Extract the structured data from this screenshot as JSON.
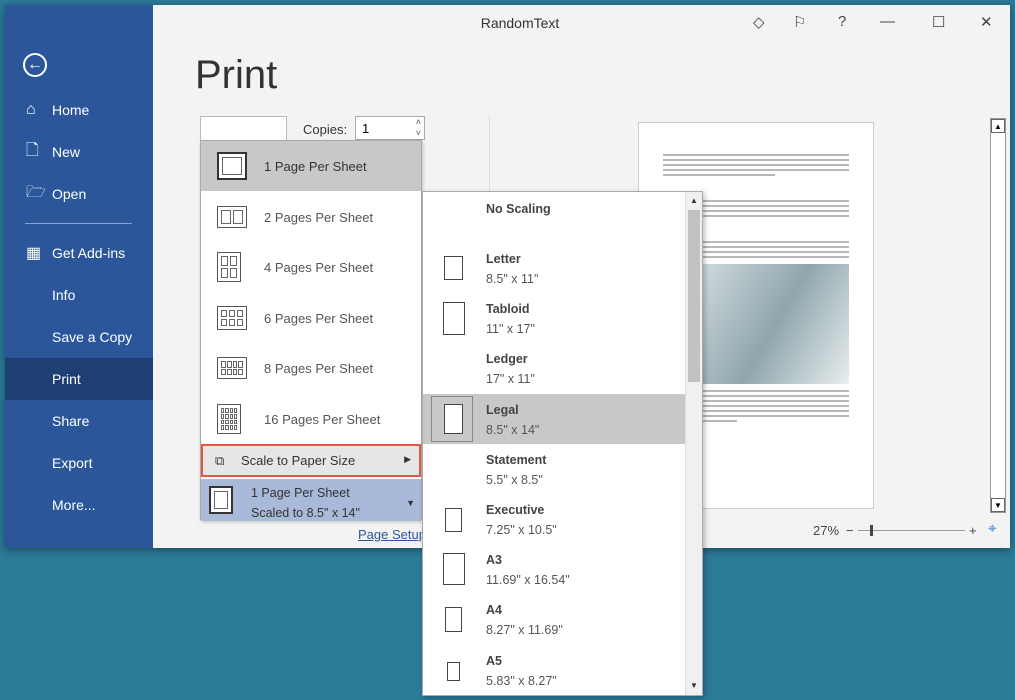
{
  "window": {
    "title": "RandomText",
    "icons": [
      "diamond-icon",
      "feedback-icon",
      "help-icon",
      "minimize-icon",
      "maximize-icon",
      "close-icon"
    ]
  },
  "sidebar": {
    "items": [
      {
        "label": "Home",
        "icon": "home-icon"
      },
      {
        "label": "New",
        "icon": "new-document-icon"
      },
      {
        "label": "Open",
        "icon": "folder-open-icon"
      },
      {
        "label": "Get Add-ins",
        "icon": "add-ins-icon"
      },
      {
        "label": "Info"
      },
      {
        "label": "Save a Copy"
      },
      {
        "label": "Print",
        "selected": true
      },
      {
        "label": "Share"
      },
      {
        "label": "Export"
      },
      {
        "label": "More..."
      }
    ]
  },
  "main": {
    "heading": "Print",
    "copies_label": "Copies:",
    "copies_value": "1",
    "page_setup": "Page Setup",
    "zoom": "27%",
    "zoom_minus": "−",
    "zoom_plus": "+"
  },
  "pages_menu": {
    "items": [
      "1 Page Per Sheet",
      "2 Pages Per Sheet",
      "4 Pages Per Sheet",
      "6 Pages Per Sheet",
      "8 Pages Per Sheet",
      "16 Pages Per Sheet"
    ],
    "selected": "1 Page Per Sheet",
    "scale_label": "Scale to Paper Size",
    "summary_line1": "1 Page Per Sheet",
    "summary_line2": "Scaled to 8.5\" x 14\""
  },
  "paper_menu": {
    "selected": "Legal",
    "items": [
      {
        "name": "No Scaling",
        "dims": ""
      },
      {
        "name": "Letter",
        "dims": "8.5\" x 11\""
      },
      {
        "name": "Tabloid",
        "dims": "11\" x 17\""
      },
      {
        "name": "Ledger",
        "dims": "17\" x 11\""
      },
      {
        "name": "Legal",
        "dims": "8.5\" x 14\""
      },
      {
        "name": "Statement",
        "dims": "5.5\" x 8.5\""
      },
      {
        "name": "Executive",
        "dims": "7.25\" x 10.5\""
      },
      {
        "name": "A3",
        "dims": "11.69\" x 16.54\""
      },
      {
        "name": "A4",
        "dims": "8.27\" x 11.69\""
      },
      {
        "name": "A5",
        "dims": "5.83\" x 8.27\""
      }
    ]
  }
}
